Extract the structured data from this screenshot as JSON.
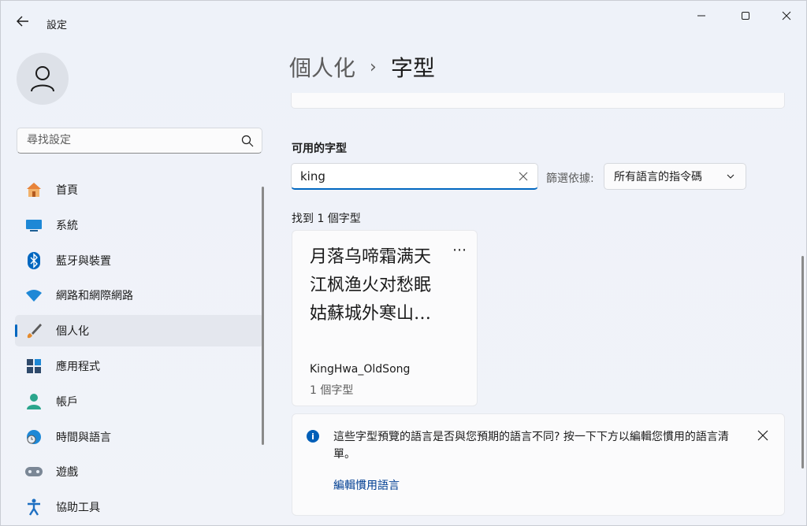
{
  "window": {
    "title": "設定"
  },
  "sidebar": {
    "search_placeholder": "尋找設定",
    "items": [
      {
        "label": "首頁",
        "icon": "home-icon"
      },
      {
        "label": "系統",
        "icon": "system-icon"
      },
      {
        "label": "藍牙與裝置",
        "icon": "bluetooth-icon"
      },
      {
        "label": "網路和網際網路",
        "icon": "wifi-icon"
      },
      {
        "label": "個人化",
        "icon": "brush-icon",
        "active": true
      },
      {
        "label": "應用程式",
        "icon": "apps-icon"
      },
      {
        "label": "帳戶",
        "icon": "account-icon"
      },
      {
        "label": "時間與語言",
        "icon": "globe-clock-icon"
      },
      {
        "label": "遊戲",
        "icon": "gamepad-icon"
      },
      {
        "label": "協助工具",
        "icon": "accessibility-icon"
      }
    ]
  },
  "breadcrumb": {
    "parent": "個人化",
    "separator": "›",
    "current": "字型"
  },
  "fonts": {
    "section_title": "可用的字型",
    "search_value": "king",
    "filter_label": "篩選依據:",
    "filter_value": "所有語言的指令碼",
    "result_count": "找到 1 個字型",
    "card": {
      "preview_lines": [
        "月落乌啼霜满天",
        "江枫渔火对愁眠",
        "姑蘇城外寒山…"
      ],
      "more": "⋯",
      "name": "KingHwa_OldSong",
      "count": "1 個字型"
    }
  },
  "info": {
    "text": "這些字型預覽的語言是否與您預期的語言不同? 按一下下方以編輯您慣用的語言清單。",
    "link": "編輯慣用語言"
  },
  "colors": {
    "accent": "#0067c0",
    "link": "#003e92"
  }
}
